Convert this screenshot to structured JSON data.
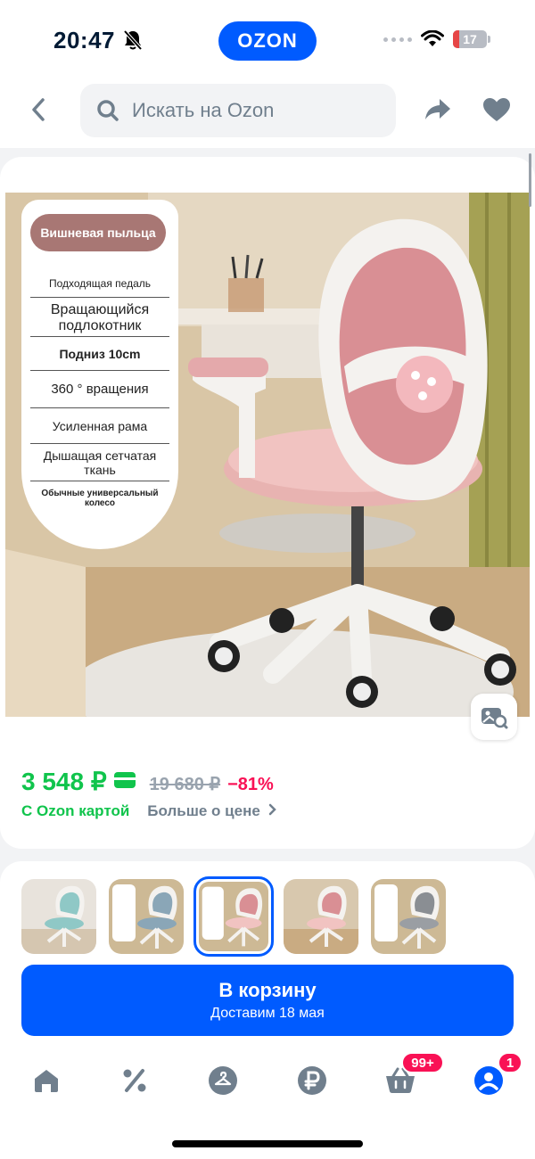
{
  "status": {
    "time": "20:47",
    "battery": "17",
    "app_pill": "OZON"
  },
  "header": {
    "search_placeholder": "Искать на Ozon"
  },
  "product": {
    "features_title": "Вишневая пыльца",
    "features": [
      "Подходящая педаль",
      "Вращающийся подлокотник",
      "Подниз 10cm",
      "360 ° вращения",
      "Усиленная рама",
      "Дышащая сетчатая ткань",
      "Обычные универсальный колесо"
    ],
    "price": "3 548 ₽",
    "old_price": "19 680 ₽",
    "discount": "−81%",
    "with_card": "С Ozon картой",
    "more_price": "Больше о цене"
  },
  "thumbnails": [
    {
      "variant": "teal",
      "selected": false
    },
    {
      "variant": "blue",
      "selected": false
    },
    {
      "variant": "pink",
      "selected": true
    },
    {
      "variant": "pink",
      "selected": false
    },
    {
      "variant": "grey",
      "selected": false
    }
  ],
  "cart": {
    "label": "В корзину",
    "delivery": "Доставим 18 мая"
  },
  "nav": {
    "cart_badge": "99+",
    "profile_badge": "1"
  },
  "colors": {
    "accent": "#005bff",
    "price_green": "#10c44c",
    "discount_red": "#f91155"
  }
}
